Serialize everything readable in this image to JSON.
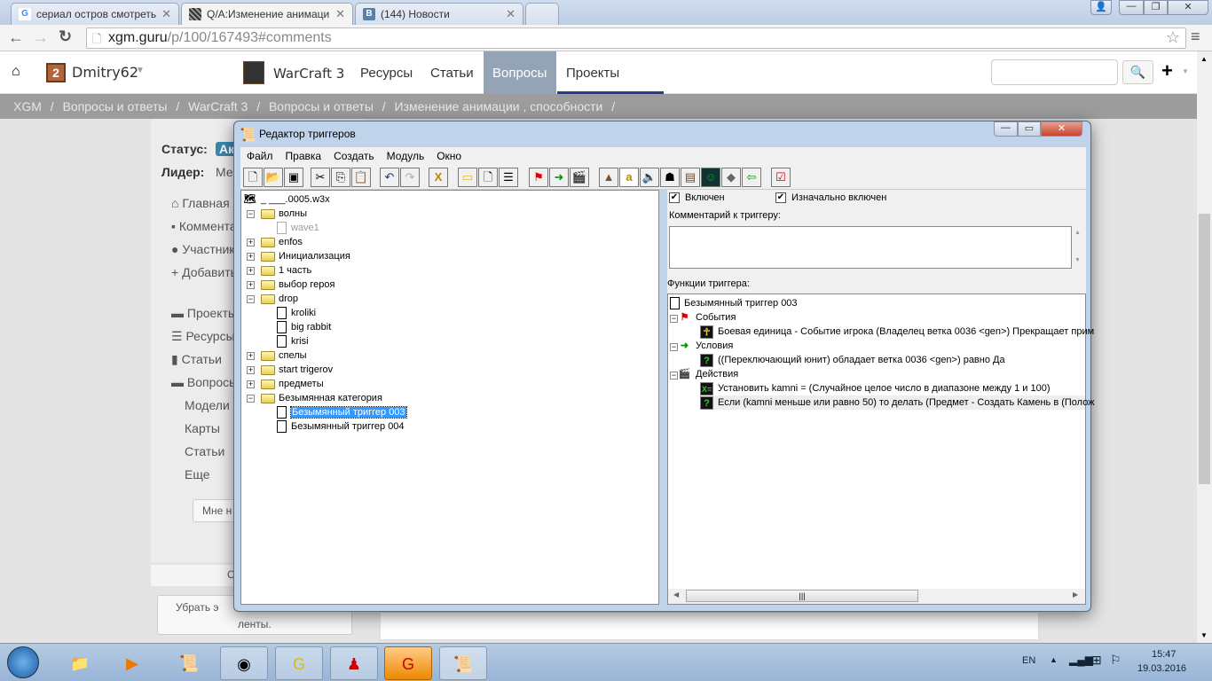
{
  "browser": {
    "tabs": [
      {
        "title": "сериал остров смотреть",
        "icon": "G"
      },
      {
        "title": "Q/A:Изменение анимаци",
        "icon": ""
      },
      {
        "title": "(144) Новости",
        "icon": "B"
      }
    ],
    "url_host": "xgm.guru",
    "url_path": "/p/100/167493#comments"
  },
  "site": {
    "user": "Dmitry62",
    "user_badge": "2",
    "nav": [
      "WarCraft 3",
      "Ресурсы",
      "Статьи",
      "Вопросы",
      "Проекты"
    ],
    "active_nav": "Вопросы",
    "breadcrumbs": [
      "XGM",
      "/",
      "Вопросы и ответы",
      "/",
      "WarCraft 3",
      "/",
      "Вопросы и ответы",
      "/",
      "Изменение анимации , способности",
      "/"
    ],
    "status_label": "Статус:",
    "status_badge": "Ак",
    "leader_label": "Лидер:",
    "leader_value": "Ме",
    "side_links": [
      "Главная",
      "Комментарии",
      "Участники",
      "Добавить"
    ],
    "side_links2": [
      "Проекты",
      "Ресурсы",
      "Статьи",
      "Вопросы"
    ],
    "sub_links": [
      "Модели",
      "Карты",
      "Статьи",
      "Еще"
    ],
    "like_button": "Мне н",
    "subscribe_partial": "С",
    "remove_button": "Убрать э",
    "remove_button_line2": "ленты."
  },
  "dialog": {
    "title": "Редактор триггеров",
    "menu": [
      "Файл",
      "Правка",
      "Создать",
      "Модуль",
      "Окно"
    ],
    "tree": [
      {
        "label": "_ ___.0005.w3x",
        "level": 0,
        "type": "map"
      },
      {
        "label": "волны",
        "level": 1,
        "type": "folder",
        "exp": "-"
      },
      {
        "label": "wave1",
        "level": 2,
        "type": "doc-disabled"
      },
      {
        "label": "enfos",
        "level": 1,
        "type": "folder",
        "exp": "+"
      },
      {
        "label": "Инициализация",
        "level": 1,
        "type": "folder",
        "exp": "+"
      },
      {
        "label": "1 часть",
        "level": 1,
        "type": "folder",
        "exp": "+"
      },
      {
        "label": "выбор героя",
        "level": 1,
        "type": "folder",
        "exp": "+"
      },
      {
        "label": "drop",
        "level": 1,
        "type": "folder",
        "exp": "-"
      },
      {
        "label": "kroliki",
        "level": 2,
        "type": "doc"
      },
      {
        "label": "big rabbit",
        "level": 2,
        "type": "doc"
      },
      {
        "label": "krisi",
        "level": 2,
        "type": "doc"
      },
      {
        "label": "спелы",
        "level": 1,
        "type": "folder",
        "exp": "+"
      },
      {
        "label": "start trigerov",
        "level": 1,
        "type": "folder",
        "exp": "+"
      },
      {
        "label": "предметы",
        "level": 1,
        "type": "folder",
        "exp": "+"
      },
      {
        "label": "Безымянная категория",
        "level": 1,
        "type": "folder",
        "exp": "-"
      },
      {
        "label": "Безымянный триггер 003",
        "level": 2,
        "type": "doc",
        "selected": true
      },
      {
        "label": "Безымянный триггер 004",
        "level": 2,
        "type": "doc"
      }
    ],
    "enabled_label": "Включен",
    "initially_enabled_label": "Изначально включен",
    "comment_label": "Комментарий к триггеру:",
    "functions_label": "Функции триггера:",
    "functions": {
      "trigger": "Безымянный триггер 003",
      "events_label": "События",
      "event": "Боевая единица - Событие игрока (Владелец ветка 0036 <gen>) Прекращает прим",
      "conditions_label": "Условия",
      "condition": "((Переключающий юнит) обладает ветка 0036 <gen>) равно Да",
      "actions_label": "Действия",
      "action1": "Установить kamni = (Случайное целое число в диапазоне между 1 и 100)",
      "action2": "Если (kamni меньше или равно 50) то делать (Предмет - Создать Камень в (Полож"
    }
  },
  "taskbar": {
    "lang": "EN",
    "time": "15:47",
    "date": "19.03.2016"
  }
}
